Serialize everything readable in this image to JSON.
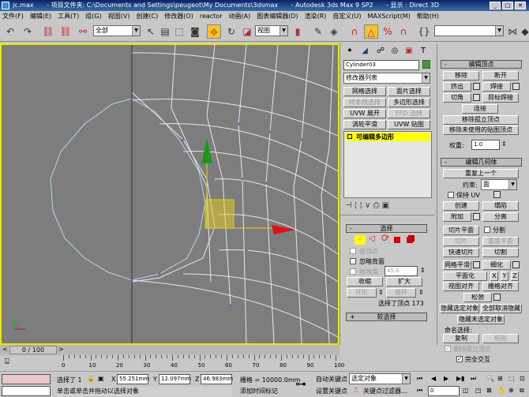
{
  "title": {
    "file": "jc.max",
    "project": "- 项目文件夹: C:\\Documents and Settings\\peugeot\\My Documents\\3dsmax",
    "app": "- Autodesk 3ds Max 9 SP2",
    "display": "- 显示 : Direct 3D"
  },
  "menu": [
    "文件(F)",
    "编辑(E)",
    "工具(T)",
    "组(G)",
    "视图(V)",
    "创建(C)",
    "修改器(O)",
    "reactor",
    "动画(A)",
    "图表编辑器(D)",
    "渲染(R)",
    "自定义(U)",
    "MAXScript(M)",
    "帮助(H)"
  ],
  "toolbar": {
    "selection_filter": "全部",
    "ref_coord": "视图",
    "named_sel": ""
  },
  "command_panel": {
    "object_name": "Cylinder03",
    "object_color": "#3aa02a",
    "modifier_list": "修改器列表",
    "mod_buttons": [
      "网格选择",
      "面片选择",
      "样条线选择",
      "多边形选择",
      "UVW 展开",
      "FFD 选择",
      "涡轮平滑",
      "UVW 贴图"
    ],
    "stack_item": "可编辑多边形",
    "selection": {
      "title": "选择",
      "by_vertex": "按顶点",
      "ignore_backface": "忽略背面",
      "by_angle": "按角度",
      "angle": "45.0",
      "shrink": "收缩",
      "grow": "扩大",
      "ring": "环形",
      "loop": "循环",
      "status": "选择了顶点 173"
    },
    "soft_selection": "软选择",
    "edit_vertices": {
      "title": "编辑顶点",
      "remove": "移除",
      "break": "断开",
      "extrude": "挤出",
      "weld": "焊接",
      "chamfer": "切角",
      "target_weld": "目标焊接",
      "connect": "连接",
      "remove_isolated": "移除孤立顶点",
      "remove_unused_map": "移除未使用的贴图顶点",
      "weight_label": "权重:",
      "weight": "1.0"
    },
    "edit_geometry": {
      "title": "编辑几何体",
      "repeat_last": "重复上一个",
      "constraints_label": "约束:",
      "constraints": "面",
      "preserve_uv": "保持 UV",
      "create": "创建",
      "collapse": "塌陷",
      "attach": "附加",
      "detach": "分离",
      "slice_plane": "切片平面",
      "split": "分割",
      "slice": "切片",
      "reset_plane": "重置平面",
      "quickslice": "快速切片",
      "cut": "切割",
      "meshsmooth": "网格平滑",
      "tessellate": "细化",
      "make_planar": "平面化",
      "x": "X",
      "y": "Y",
      "z": "Z",
      "view_align": "视图对齐",
      "grid_align": "栅格对齐",
      "relax": "松弛",
      "hide_selected": "隐藏选定对象",
      "unhide_all": "全部取消隐藏",
      "hide_unselected": "隐藏未选定对象",
      "named_sel_label": "命名选择:",
      "copy": "复制",
      "paste": "粘贴",
      "delete_isolated": "删除孤立顶点",
      "full_interactivity": "完全交互"
    }
  },
  "timeline": {
    "frame": "0 / 100",
    "ticks": [
      "0",
      "10",
      "20",
      "30",
      "40",
      "50",
      "60",
      "70",
      "80",
      "90",
      "100"
    ]
  },
  "status": {
    "selected": "选择了 1",
    "x_label": "X",
    "x": "55.251mm",
    "y_label": "Y",
    "y": "12.097mm",
    "z_label": "Z",
    "z": "46.983mm",
    "grid": "栅格 = 10000.0mm",
    "prompt": "单击或单击并拖动以选择对象",
    "add_time_tag": "添加时间标记",
    "auto_key": "自动关键点",
    "set_key": "设置关键点",
    "key_mode": "选定对象",
    "key_filters": "关键点过滤器...",
    "current_frame": "0"
  }
}
